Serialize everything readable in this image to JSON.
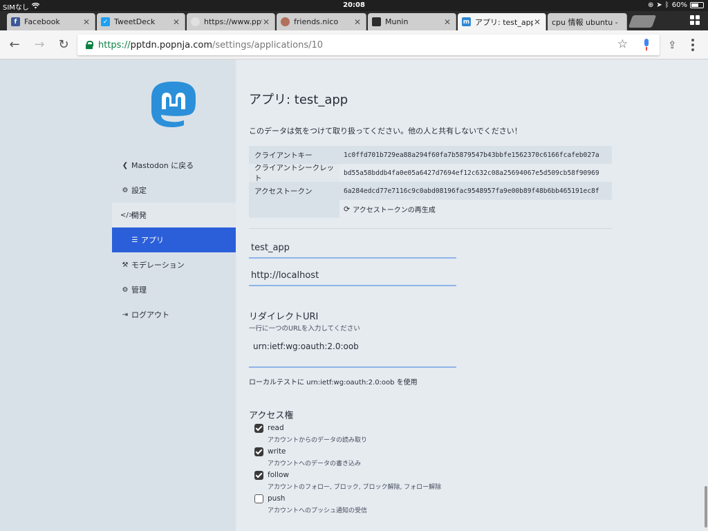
{
  "status": {
    "carrier": "SIMなし",
    "time": "20:08",
    "battery": "60%",
    "battery_level": 0.6
  },
  "tabs": [
    {
      "label": "Facebook",
      "icon": "facebook-icon",
      "color": "#3b5998"
    },
    {
      "label": "TweetDeck",
      "icon": "tweetdeck-icon",
      "color": "#1da1f2"
    },
    {
      "label": "https://www.pptd",
      "icon": "globe-icon",
      "color": "#dddddd"
    },
    {
      "label": "friends.nico",
      "icon": "friends-nico-icon",
      "color": "#b0705a"
    },
    {
      "label": "Munin",
      "icon": "munin-icon",
      "color": "#2c2c2c"
    },
    {
      "label": "アプリ: test_app -",
      "icon": "mastodon-icon",
      "color": "#3088d4"
    },
    {
      "label": "cpu 情報 ubuntu -",
      "icon": "none",
      "color": "#cccccc"
    }
  ],
  "url": {
    "scheme": "https://",
    "host": "pptdn.popnja.com",
    "path": "/settings/applications/10"
  },
  "sidebar": {
    "items": [
      {
        "label": "Mastodon に戻る",
        "icon": "chevron-left-icon"
      },
      {
        "label": "設定",
        "icon": "gear-icon"
      },
      {
        "label": "開発",
        "icon": "code-icon"
      },
      {
        "label": "アプリ",
        "icon": "list-icon"
      },
      {
        "label": "モデレーション",
        "icon": "gavel-icon"
      },
      {
        "label": "管理",
        "icon": "cogs-icon"
      },
      {
        "label": "ログアウト",
        "icon": "sign-out-icon"
      }
    ]
  },
  "main": {
    "title": "アプリ: test_app",
    "warning": "このデータは気をつけて取り扱ってください。他の人と共有しないでください！",
    "keys": [
      {
        "label": "クライアントキー",
        "value": "1c0ffd701b729ea88a294f60fa7b5879547b43bbfe1562370c6166fcafeb027a"
      },
      {
        "label": "クライアントシークレット",
        "value": "bd55a58bddb4fa0e05a6427d7694ef12c632c08a25694067e5d509cb58f90969"
      },
      {
        "label": "アクセストークン",
        "value": "6a284edcd77e7116c9c0abd08196fac9548957fa9e00b89f48b6bb465191ec8f"
      }
    ],
    "regenerate": "アクセストークンの再生成",
    "app_name": "test_app",
    "website": "http://localhost",
    "redirect_label": "リダイレクトURI",
    "redirect_hint": "一行に一つのURLを入力してください",
    "redirect_value": "urn:ietf:wg:oauth:2.0:oob",
    "local_test": "ローカルテストに urn:ietf:wg:oauth:2.0:oob を使用",
    "scopes_label": "アクセス権",
    "scopes": [
      {
        "name": "read",
        "desc": "アカウントからのデータの読み取り",
        "checked": true
      },
      {
        "name": "write",
        "desc": "アカウントへのデータの書き込み",
        "checked": true
      },
      {
        "name": "follow",
        "desc": "アカウントのフォロー, ブロック, ブロック解除, フォロー解除",
        "checked": true
      },
      {
        "name": "push",
        "desc": "アカウントへのプッシュ通知の受信",
        "checked": false
      }
    ]
  }
}
